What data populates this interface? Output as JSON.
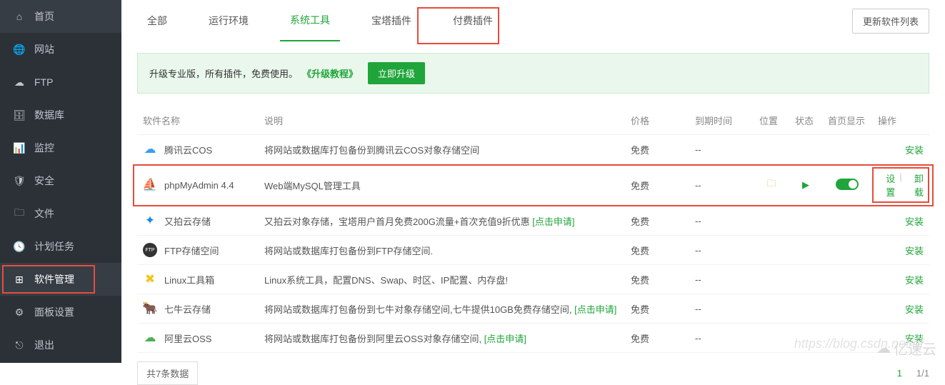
{
  "sidebar": {
    "items": [
      {
        "label": "首页",
        "icon": "home"
      },
      {
        "label": "网站",
        "icon": "globe"
      },
      {
        "label": "FTP",
        "icon": "cloud"
      },
      {
        "label": "数据库",
        "icon": "db"
      },
      {
        "label": "监控",
        "icon": "monitor"
      },
      {
        "label": "安全",
        "icon": "shield"
      },
      {
        "label": "文件",
        "icon": "folder"
      },
      {
        "label": "计划任务",
        "icon": "clock"
      },
      {
        "label": "软件管理",
        "icon": "grid"
      },
      {
        "label": "面板设置",
        "icon": "gear"
      },
      {
        "label": "退出",
        "icon": "exit"
      }
    ],
    "active_index": 8
  },
  "tabs": {
    "items": [
      "全部",
      "运行环境",
      "系统工具",
      "宝塔插件",
      "付费插件"
    ],
    "active_index": 2,
    "update_btn": "更新软件列表"
  },
  "banner": {
    "text": "升级专业版，所有插件，免费使用。",
    "tutorial": "《升级教程》",
    "btn": "立即升级"
  },
  "table": {
    "headers": {
      "name": "软件名称",
      "desc": "说明",
      "price": "价格",
      "expire": "到期时间",
      "loc": "位置",
      "status": "状态",
      "home": "首页显示",
      "action": "操作"
    },
    "rows": [
      {
        "icon": "#3a9ff2",
        "icon_glyph": "☁",
        "name": "腾讯云COS",
        "desc": "将网站或数据库打包备份到腾讯云COS对象存储空间",
        "price": "免费",
        "expire": "--",
        "action": "安装"
      },
      {
        "icon": "#e8a33d",
        "icon_glyph": "⛵",
        "name": "phpMyAdmin 4.4",
        "desc": "Web端MySQL管理工具",
        "price": "免费",
        "expire": "--",
        "installed": true,
        "action": "设置",
        "action2": "卸载",
        "hl": true
      },
      {
        "icon": "#1e88e5",
        "icon_glyph": "✦",
        "name": "又拍云存储",
        "desc": "又拍云对象存储，宝塔用户首月免费200G流量+首次充值9折优惠 ",
        "link": "[点击申请]",
        "price": "免费",
        "expire": "--",
        "action": "安装"
      },
      {
        "icon": "#333",
        "icon_glyph": "FTP",
        "name": "FTP存储空间",
        "desc": "将网站或数据库打包备份到FTP存储空间.",
        "price": "免费",
        "expire": "--",
        "action": "安装"
      },
      {
        "icon": "#f5c518",
        "icon_glyph": "✖",
        "name": "Linux工具箱",
        "desc": "Linux系统工具，配置DNS、Swap、时区、IP配置、内存盘!",
        "price": "免费",
        "expire": "--",
        "action": "安装"
      },
      {
        "icon": "#3a9ff2",
        "icon_glyph": "🐂",
        "name": "七牛云存储",
        "desc": "将网站或数据库打包备份到七牛对象存储空间,七牛提供10GB免费存储空间, ",
        "link": "[点击申请]",
        "price": "免费",
        "expire": "--",
        "action": "安装"
      },
      {
        "icon": "#4caf50",
        "icon_glyph": "☁",
        "name": "阿里云OSS",
        "desc": "将网站或数据库打包备份到阿里云OSS对象存储空间, ",
        "link": "[点击申请]",
        "price": "免费",
        "expire": "--",
        "action": "安装"
      }
    ]
  },
  "footer": {
    "count": "共7条数据",
    "page_cur": "1",
    "page_total": "1/1"
  },
  "watermark": "https://blog.csdn.net/qf",
  "brand": "亿速云"
}
